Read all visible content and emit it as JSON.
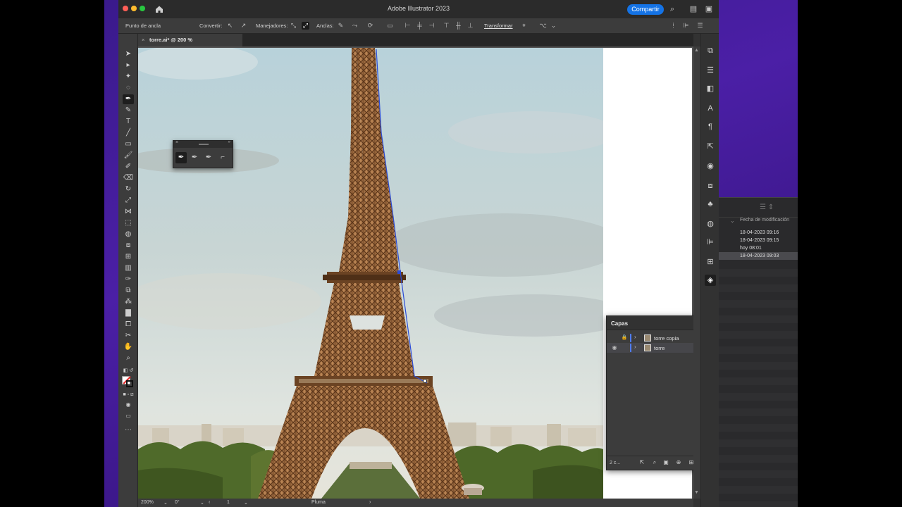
{
  "app": {
    "title": "Adobe Illustrator 2023",
    "share_label": "Compartir"
  },
  "controlbar": {
    "anchor_point_label": "Punto de ancla",
    "convert_label": "Convertir:",
    "handles_label": "Manejadores:",
    "anchors_label": "Anclas:",
    "transform_label": "Transformar"
  },
  "document": {
    "tab_label": "torre.ai* @ 200 % (RGB/Previsualizar)"
  },
  "statusbar": {
    "zoom": "200%",
    "rotation": "0°",
    "artboard": "1",
    "tool_name": "Pluma"
  },
  "layers_panel": {
    "title": "Capas",
    "layers": [
      {
        "name": "torre copia",
        "visible": false,
        "locked": true,
        "selected": false
      },
      {
        "name": "torre",
        "visible": true,
        "locked": false,
        "selected": true
      }
    ],
    "count_label": "2 c..."
  },
  "finder": {
    "column_header": "Fecha de modificación",
    "rows": [
      {
        "date": "18-04-2023 09:16",
        "selected": false
      },
      {
        "date": "18-04-2023 09:15",
        "selected": false
      },
      {
        "date": "hoy 08:01",
        "selected": false
      },
      {
        "date": "18-04-2023 09:03",
        "selected": true
      }
    ]
  },
  "colors": {
    "accent": "#1473e6",
    "layer_color": "#4f7cff",
    "desktop": "#4b1fa6"
  }
}
